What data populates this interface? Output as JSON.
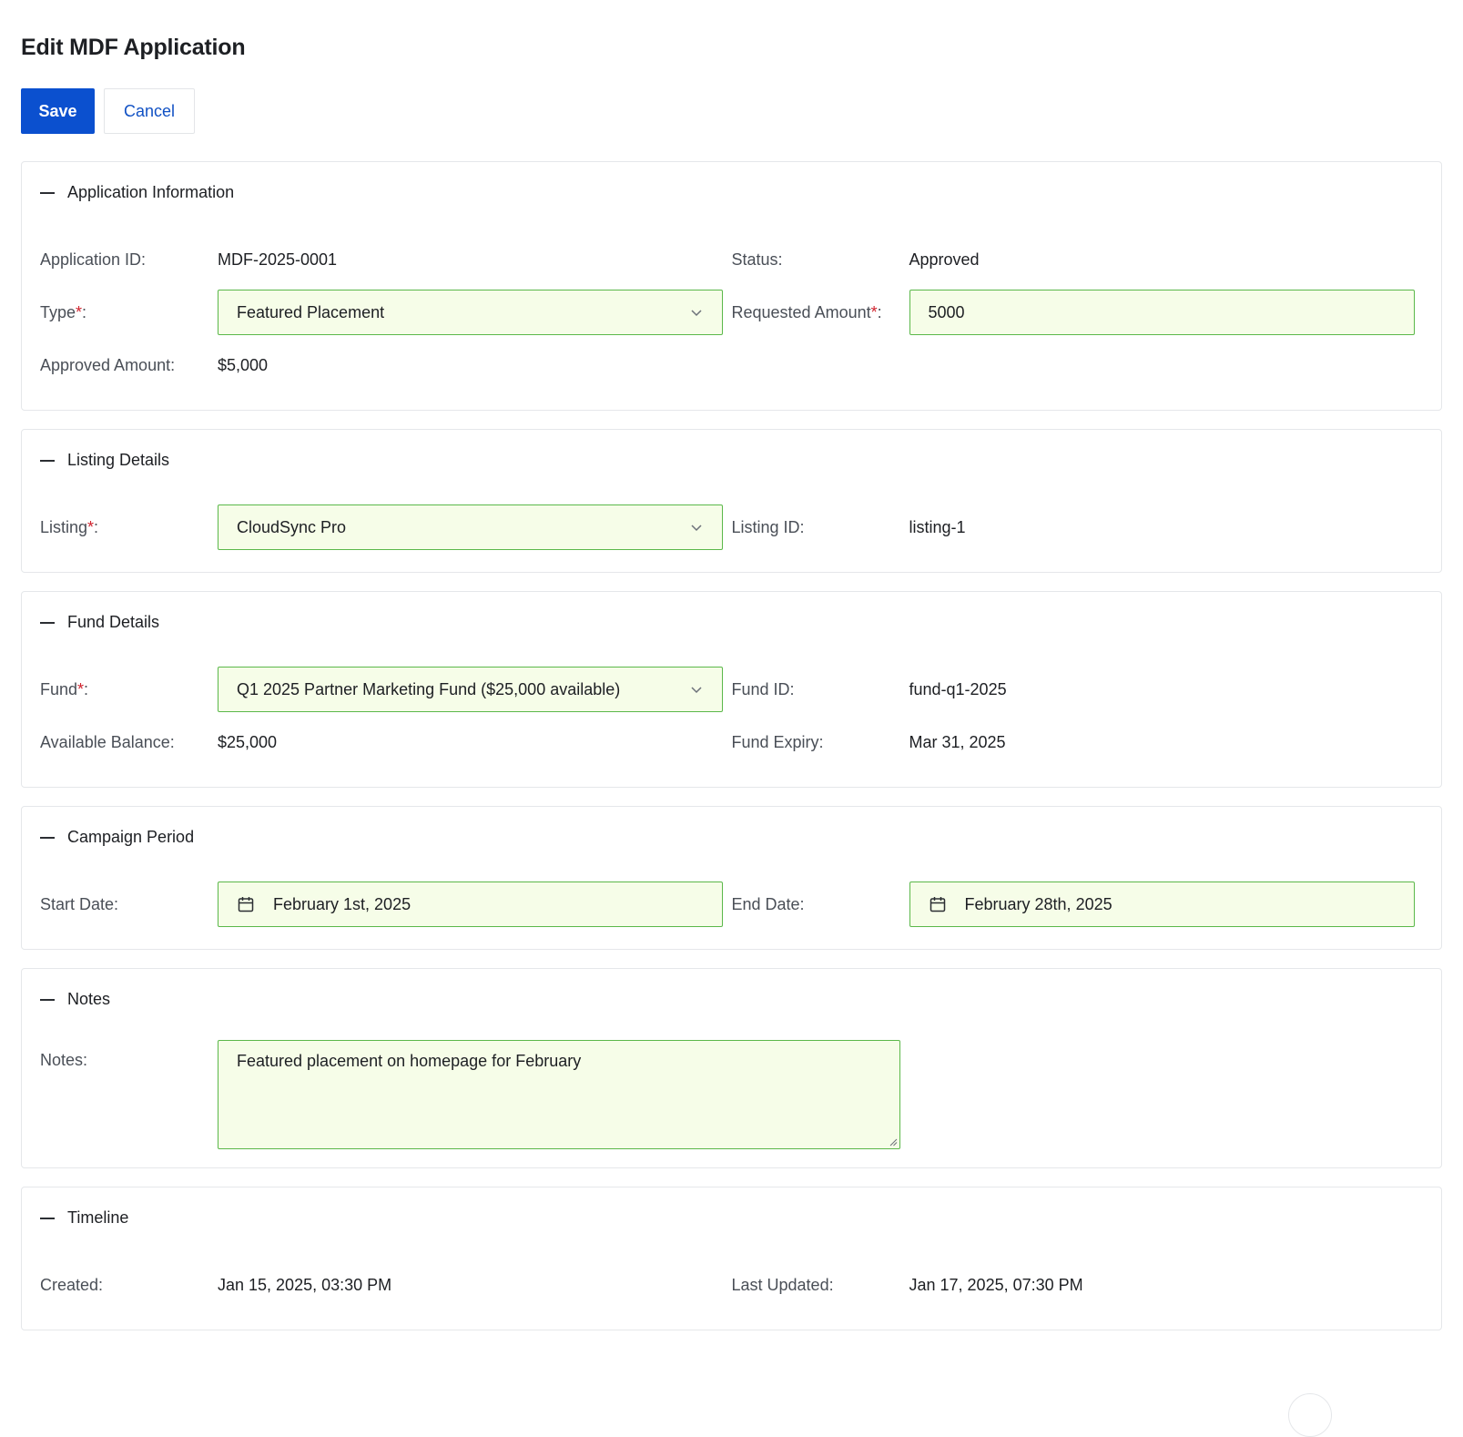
{
  "page": {
    "title": "Edit MDF Application"
  },
  "toolbar": {
    "save_label": "Save",
    "cancel_label": "Cancel"
  },
  "sections": {
    "application_info": {
      "title": "Application Information",
      "application_id_label": "Application ID:",
      "application_id_value": "MDF-2025-0001",
      "status_label": "Status:",
      "status_value": "Approved",
      "type_label": "Type",
      "type_value": "Featured Placement",
      "requested_amount_label": "Requested Amount",
      "requested_amount_value": "5000",
      "approved_amount_label": "Approved Amount:",
      "approved_amount_value": "$5,000"
    },
    "listing_details": {
      "title": "Listing Details",
      "listing_label": "Listing",
      "listing_value": "CloudSync Pro",
      "listing_id_label": "Listing ID:",
      "listing_id_value": "listing-1"
    },
    "fund_details": {
      "title": "Fund Details",
      "fund_label": "Fund",
      "fund_value": "Q1 2025 Partner Marketing Fund ($25,000 available)",
      "fund_id_label": "Fund ID:",
      "fund_id_value": "fund-q1-2025",
      "available_balance_label": "Available Balance:",
      "available_balance_value": "$25,000",
      "fund_expiry_label": "Fund Expiry:",
      "fund_expiry_value": "Mar 31, 2025"
    },
    "campaign_period": {
      "title": "Campaign Period",
      "start_date_label": "Start Date:",
      "start_date_value": "February 1st, 2025",
      "end_date_label": "End Date:",
      "end_date_value": "February 28th, 2025"
    },
    "notes": {
      "title": "Notes",
      "notes_label": "Notes:",
      "notes_value": "Featured placement on homepage for February"
    },
    "timeline": {
      "title": "Timeline",
      "created_label": "Created:",
      "created_value": "Jan 15, 2025, 03:30 PM",
      "last_updated_label": "Last Updated:",
      "last_updated_value": "Jan 17, 2025, 07:30 PM"
    }
  },
  "common": {
    "required_marker": "*",
    "label_suffix": ":"
  },
  "icons": {
    "collapse": "minus-icon",
    "select": "chevron-down-icon",
    "date": "calendar-icon",
    "resize": "resize-handle-icon"
  },
  "colors": {
    "primary": "#0b50cf",
    "field_background": "#f6fde8",
    "field_border": "#5bb84a",
    "required": "#d0232e"
  }
}
